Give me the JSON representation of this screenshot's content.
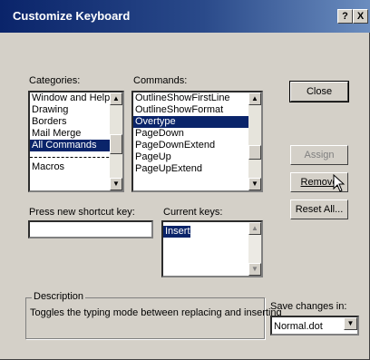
{
  "window": {
    "title": "Customize Keyboard",
    "help_btn": "?",
    "close_btn": "X"
  },
  "categories": {
    "label": "Categories:",
    "items": [
      "Window and Help",
      "Drawing",
      "Borders",
      "Mail Merge",
      "All Commands",
      "Macros"
    ],
    "selected_index": 4
  },
  "commands": {
    "label": "Commands:",
    "items": [
      "OutlineShowFirstLine",
      "OutlineShowFormat",
      "Overtype",
      "PageDown",
      "PageDownExtend",
      "PageUp",
      "PageUpExtend"
    ],
    "selected_index": 2
  },
  "buttons": {
    "close": "Close",
    "assign": "Assign",
    "remove": "Remove",
    "reset_all": "Reset All..."
  },
  "shortcut": {
    "label": "Press new shortcut key:",
    "value": ""
  },
  "current_keys": {
    "label": "Current keys:",
    "items": [
      "Insert"
    ]
  },
  "description": {
    "legend": "Description",
    "text": "Toggles the typing mode between replacing and inserting"
  },
  "save_in": {
    "label": "Save changes in:",
    "value": "Normal.dot"
  },
  "colors": {
    "titlebar": "#0a246a",
    "face": "#d4d0c8",
    "selection": "#0a246a"
  }
}
